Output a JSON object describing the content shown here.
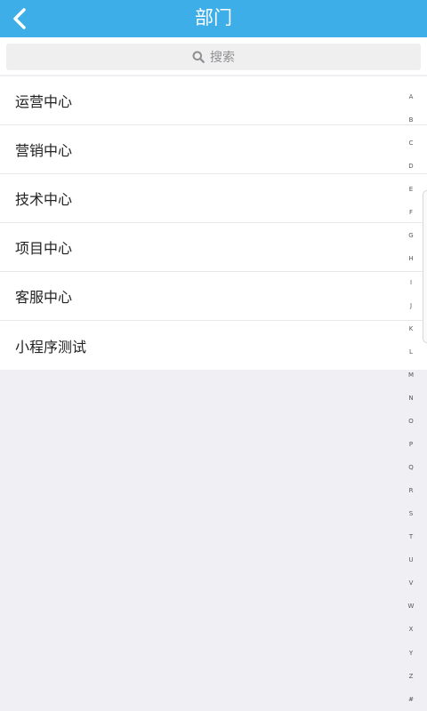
{
  "header": {
    "title": "部门",
    "back_icon": "chevron-left-icon",
    "background": "#3eaee8"
  },
  "search": {
    "placeholder": "搜索",
    "icon": "search-icon"
  },
  "departments": [
    {
      "label": "运营中心"
    },
    {
      "label": "营销中心"
    },
    {
      "label": "技术中心"
    },
    {
      "label": "项目中心"
    },
    {
      "label": "客服中心"
    },
    {
      "label": "小程序测试"
    }
  ],
  "index_bar": [
    "A",
    "B",
    "C",
    "D",
    "E",
    "F",
    "G",
    "H",
    "I",
    "J",
    "K",
    "L",
    "M",
    "N",
    "O",
    "P",
    "Q",
    "R",
    "S",
    "T",
    "U",
    "V",
    "W",
    "X",
    "Y",
    "Z",
    "#"
  ]
}
